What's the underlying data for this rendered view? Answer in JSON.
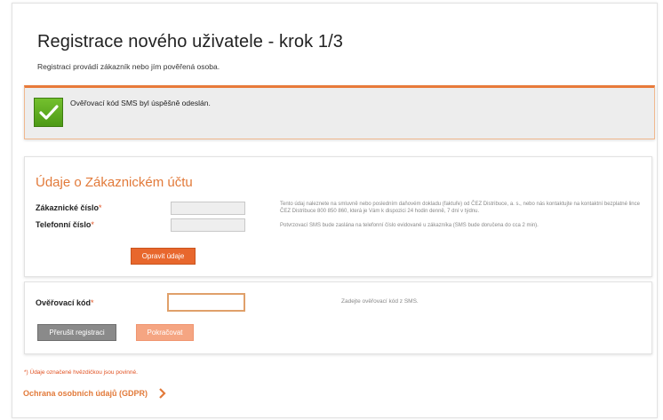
{
  "page": {
    "title": "Registrace nového uživatele - krok 1/3",
    "subtitle": "Registraci provádí zákazník nebo jím pověřená osoba."
  },
  "alert": {
    "message": "Ověřovací kód SMS byl úspěšně odeslán.",
    "icon": "checkmark-icon",
    "accent": "#e87a3a",
    "icon_color": "#5aaa1e"
  },
  "account": {
    "title": "Údaje o Zákaznickém účtu",
    "customer_number_label": "Zákaznické číslo",
    "customer_number_value": "",
    "phone_label": "Telefonní číslo",
    "phone_value": "",
    "required_mark": "*",
    "customer_number_hint": "Tento údaj naleznete na smluvně nebo posledním daňovém dokladu (faktuře) od ČEZ Distribuce, a. s., nebo nás kontaktujte na kontaktní bezplatné lince ČEZ Distribuce 800 850 860, která je Vám k dispozici 24 hodin denně, 7 dní v týdnu.",
    "phone_hint": "Potvrzovací SMS bude zaslána na telefonní číslo evidované u zákazníka (SMS bude doručena do cca 2 min).",
    "edit_button": "Opravit údaje"
  },
  "verification": {
    "code_label": "Ověřovací kód",
    "code_value": "",
    "code_hint": "Zadejte ověřovací kód z SMS.",
    "cancel_button": "Přerušit registraci",
    "continue_button": "Pokračovat"
  },
  "footer": {
    "required_note": "*) Údaje označené hvězdičkou jsou povinné.",
    "gdpr_link": "Ochrana osobních údajů (GDPR)",
    "gdpr_icon": "chevron-right-icon"
  },
  "colors": {
    "brand_orange": "#e8672d",
    "heading_orange": "#e27a3a",
    "button_gray": "#8a8a8a"
  }
}
